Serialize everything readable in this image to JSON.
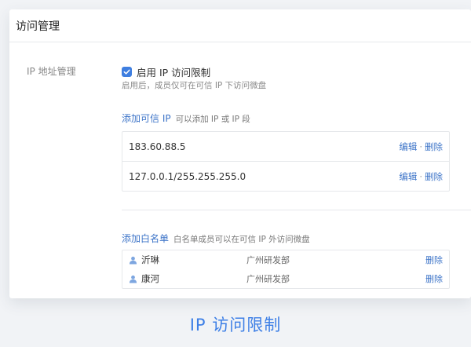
{
  "header": {
    "title": "访问管理"
  },
  "ip_section": {
    "label": "IP 地址管理",
    "enable_label": "启用 IP 访问限制",
    "enabled": true,
    "hint": "启用后，成员仅可在可信 IP 下访问微盘"
  },
  "trusted_ip": {
    "title": "添加可信 IP",
    "subtitle": "可以添加 IP 或 IP 段",
    "rows": [
      {
        "address": "183.60.88.5",
        "edit": "编辑",
        "sep": "·",
        "delete": "删除"
      },
      {
        "address": "127.0.0.1/255.255.255.0",
        "edit": "编辑",
        "sep": "·",
        "delete": "删除"
      }
    ]
  },
  "whitelist": {
    "title": "添加白名单",
    "subtitle": "白名单成员可以在可信 IP 外访问微盘",
    "rows": [
      {
        "name": "沂琳",
        "dept": "广州研发部",
        "delete": "删除"
      },
      {
        "name": "康河",
        "dept": "广州研发部",
        "delete": "删除"
      }
    ]
  },
  "caption": "IP 访问限制",
  "colors": {
    "accent": "#3d74c8",
    "checkbox": "#3e7ee0",
    "caption": "#3d7fe6"
  }
}
